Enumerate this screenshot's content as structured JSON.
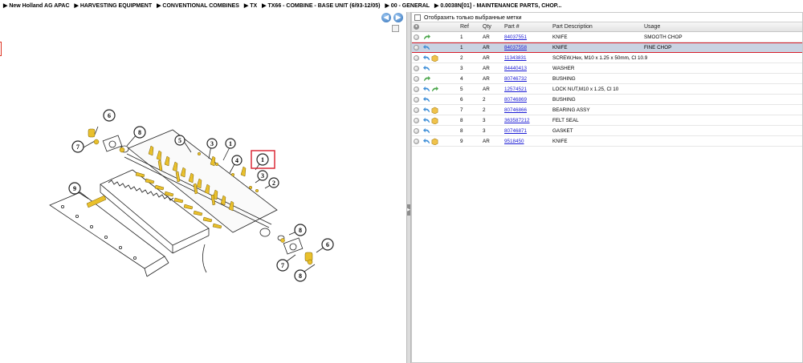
{
  "breadcrumb": [
    "▶ New Holland AG APAC",
    "▶ HARVESTING EQUIPMENT",
    "▶ CONVENTIONAL COMBINES",
    "▶ TX",
    "▶ TX66 - COMBINE - BASE UNIT (6/93-12/05)",
    "▶ 00 - GENERAL",
    "▶ 0.0038N[01] - MAINTENANCE PARTS, CHOP..."
  ],
  "nav": {
    "back": "◀",
    "forward": "▶"
  },
  "filter": {
    "label": "Отобразить только выбранные метки"
  },
  "columns": {
    "ref": "Ref",
    "qty": "Qty",
    "part": "Part #",
    "desc": "Part Description",
    "usage": "Usage"
  },
  "rows": [
    {
      "ref": "1",
      "qty": "AR",
      "part": "84037551",
      "desc": "KNIFE",
      "usage": "SMOOTH CHOP",
      "icons": [
        "green-arrow"
      ]
    },
    {
      "ref": "1",
      "qty": "AR",
      "part": "84037558",
      "desc": "KNIFE",
      "usage": "FINE CHOP",
      "icons": [
        "blue-arrow"
      ]
    },
    {
      "ref": "2",
      "qty": "AR",
      "part": "11343831",
      "desc": "SCREW,Hex, M10 x 1.25 x 50mm, Cl 10.9",
      "usage": "",
      "icons": [
        "blue-arrow",
        "box"
      ]
    },
    {
      "ref": "3",
      "qty": "AR",
      "part": "84440413",
      "desc": "WASHER",
      "usage": "",
      "icons": [
        "blue-arrow"
      ]
    },
    {
      "ref": "4",
      "qty": "AR",
      "part": "80746732",
      "desc": "BUSHING",
      "usage": "",
      "icons": [
        "green-arrow"
      ]
    },
    {
      "ref": "5",
      "qty": "AR",
      "part": "12574521",
      "desc": "LOCK NUT,M10 x 1.25, Cl 10",
      "usage": "",
      "icons": [
        "blue-arrow",
        "green-arrow"
      ]
    },
    {
      "ref": "6",
      "qty": "2",
      "part": "80746869",
      "desc": "BUSHING",
      "usage": "",
      "icons": [
        "blue-arrow"
      ]
    },
    {
      "ref": "7",
      "qty": "2",
      "part": "80746866",
      "desc": "BEARING ASSY",
      "usage": "",
      "icons": [
        "blue-arrow",
        "box"
      ]
    },
    {
      "ref": "8",
      "qty": "3",
      "part": "363587212",
      "desc": "FELT SEAL",
      "usage": "",
      "icons": [
        "blue-arrow",
        "box"
      ]
    },
    {
      "ref": "8",
      "qty": "3",
      "part": "80746871",
      "desc": "GASKET",
      "usage": "",
      "icons": [
        "blue-arrow"
      ]
    },
    {
      "ref": "9",
      "qty": "AR",
      "part": "9518450",
      "desc": "KNIFE",
      "usage": "",
      "icons": [
        "blue-arrow",
        "box"
      ]
    }
  ],
  "callouts": [
    "1",
    "1",
    "2",
    "3",
    "3",
    "4",
    "5",
    "6",
    "6",
    "7",
    "7",
    "8",
    "8",
    "8",
    "9"
  ],
  "colors": {
    "selection": "#c9d3e2",
    "highlight": "#d81d2a",
    "knife": "#e9c02c",
    "link": "#1a1ad4"
  }
}
